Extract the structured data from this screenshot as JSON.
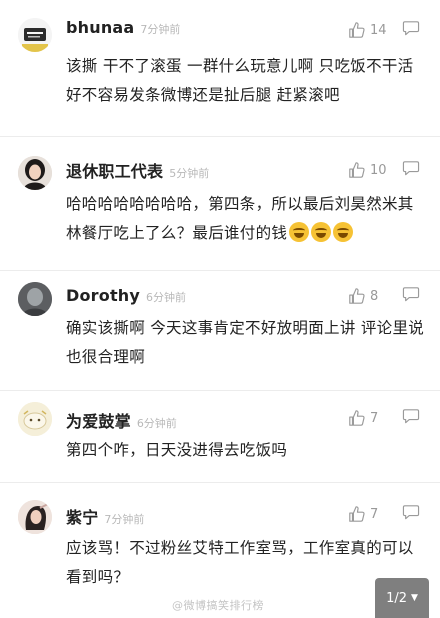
{
  "comments": [
    {
      "name": "bhunaa",
      "time": "7分钟前",
      "likes": "14",
      "text": "该撕 干不了滚蛋 一群什么玩意儿啊 只吃饭不干活 好不容易发条微博还是扯后腿 赶紧滚吧",
      "avatar": "avatar-bhunaa"
    },
    {
      "name": "退休职工代表",
      "time": "5分钟前",
      "likes": "10",
      "text": "哈哈哈哈哈哈哈哈，第四条，所以最后刘昊然米其林餐厅吃上了么？最后谁付的钱",
      "emoji_count": 3,
      "avatar": "avatar-retired-rep"
    },
    {
      "name": "Dorothy",
      "time": "6分钟前",
      "likes": "8",
      "text": "确实该撕啊 今天这事肯定不好放明面上讲 评论里说也很合理啊",
      "avatar": "avatar-dorothy"
    },
    {
      "name": "为爱鼓掌",
      "time": "6分钟前",
      "likes": "7",
      "text": "第四个咋，日天没进得去吃饭吗",
      "avatar": "avatar-applause"
    },
    {
      "name": "紫宁",
      "time": "7分钟前",
      "likes": "7",
      "text": "应该骂！不过粉丝艾特工作室骂，工作室真的可以看到吗？",
      "avatar": "avatar-zining"
    }
  ],
  "pager": {
    "label": "1/2",
    "caret": "▼"
  },
  "icons": {
    "like": "thumbs-up-icon",
    "reply": "comment-bubble-icon"
  },
  "colors": {
    "name": "#222222",
    "meta": "#b8b8b8",
    "count": "#999999",
    "pager_bg": "#7f7f7f"
  },
  "watermark": "@微博搞笑排行榜"
}
